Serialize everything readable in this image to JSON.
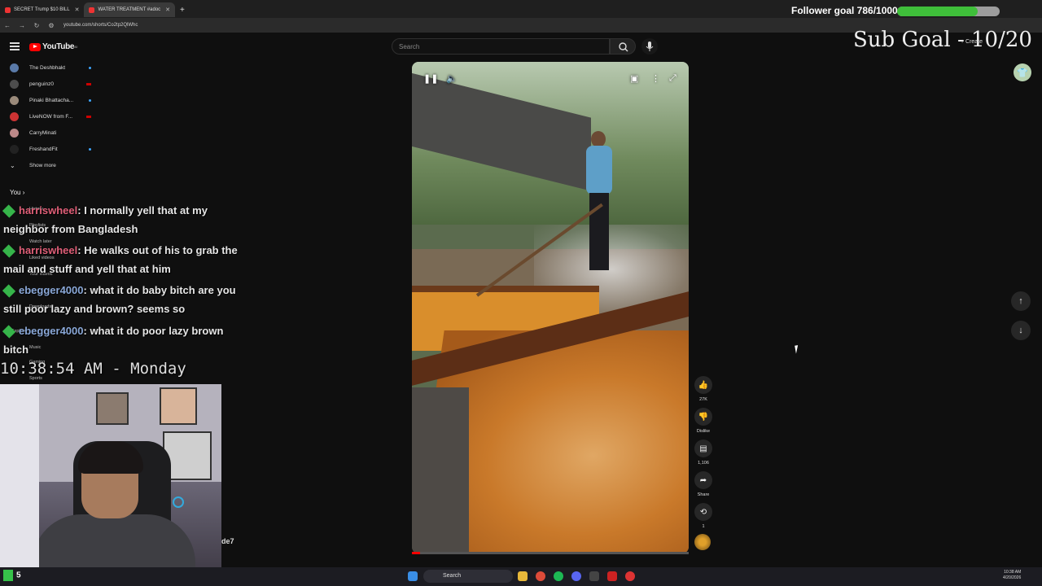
{
  "browser": {
    "tabs": [
      {
        "label": "SECRET Trump $10 BILL",
        "active": false
      },
      {
        "label": "WATER TREATMENT #adoc",
        "active": true
      }
    ],
    "new_tab": "+",
    "url": "youtube.com/shorts/Co2tp2QlWhc"
  },
  "overlay": {
    "follower_goal": "Follower goal 786/1000",
    "follower_progress": 0.786,
    "sub_goal": "Sub Goal - 10/20"
  },
  "youtube": {
    "logo": "YouTube",
    "logo_sup": "80",
    "search_placeholder": "Search",
    "create": "+ Create"
  },
  "sidebar": {
    "subscriptions": [
      {
        "label": "The Deshbhakt",
        "indicator": "dot"
      },
      {
        "label": "penguinz0",
        "indicator": "live"
      },
      {
        "label": "Pinaki Bhattacha...",
        "indicator": "dot"
      },
      {
        "label": "LiveNOW from F...",
        "indicator": "live"
      },
      {
        "label": "CarryMinati",
        "indicator": "none"
      },
      {
        "label": "FreshandFit",
        "indicator": "dot"
      }
    ],
    "show_more": "Show more",
    "you_label": "You",
    "you_items": [
      "History",
      "Playlists",
      "Watch later",
      "Liked videos",
      "Your videos",
      "Downloads",
      "Explore",
      "Music",
      "Gaming",
      "Sports"
    ]
  },
  "chat": [
    {
      "user": "harriswheel",
      "text": ": I normally yell that at my neighbor from Bangladesh"
    },
    {
      "user": "harriswheel",
      "text": ": He walks out of his to grab the mail and stuff and yell that at him"
    },
    {
      "user": "ebegger4000",
      "text": ": what it do baby bitch are you still poor lazy and brown? seems so"
    },
    {
      "user": "ebegger4000",
      "text": ": what it do poor lazy brown bitch"
    }
  ],
  "clock": "10:38:54 AM - Monday",
  "webcam_username": "de7",
  "actions": {
    "like_count": "27K",
    "dislike_label": "Dislike",
    "comment_count": "1,106",
    "share_label": "Share",
    "remix_count": "1"
  },
  "video_progress": 0.03,
  "taskbar": {
    "search": "Search",
    "badge_count": "5",
    "time": "10:38 AM",
    "date": "4/20/2026"
  }
}
